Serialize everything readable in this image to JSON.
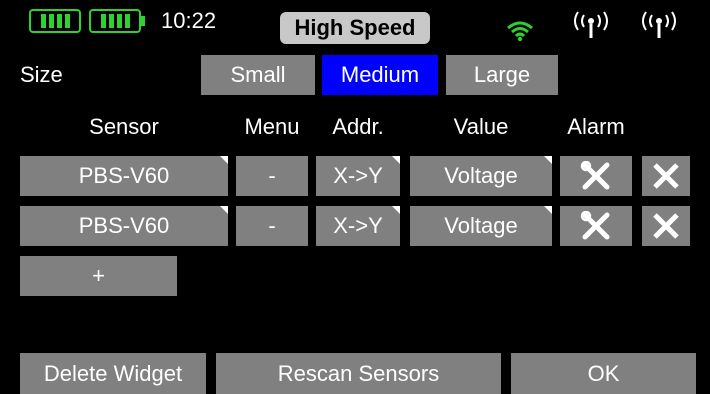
{
  "status_bar": {
    "time": "10:22",
    "mode": "High Speed"
  },
  "size_row": {
    "label": "Size",
    "options": [
      "Small",
      "Medium",
      "Large"
    ],
    "selected": "Medium"
  },
  "table": {
    "headers": [
      "Sensor",
      "Menu",
      "Addr.",
      "Value",
      "Alarm"
    ],
    "rows": [
      {
        "sensor": "PBS-V60",
        "menu": "-",
        "addr": "X->Y",
        "value": "Voltage"
      },
      {
        "sensor": "PBS-V60",
        "menu": "-",
        "addr": "X->Y",
        "value": "Voltage"
      }
    ],
    "add_label": "+"
  },
  "footer": {
    "delete_label": "Delete Widget",
    "rescan_label": "Rescan Sensors",
    "ok_label": "OK"
  },
  "colors": {
    "battery": "#2fd12f",
    "wifi": "#2fd12f",
    "selected": "#0000ff",
    "button": "#808080"
  }
}
